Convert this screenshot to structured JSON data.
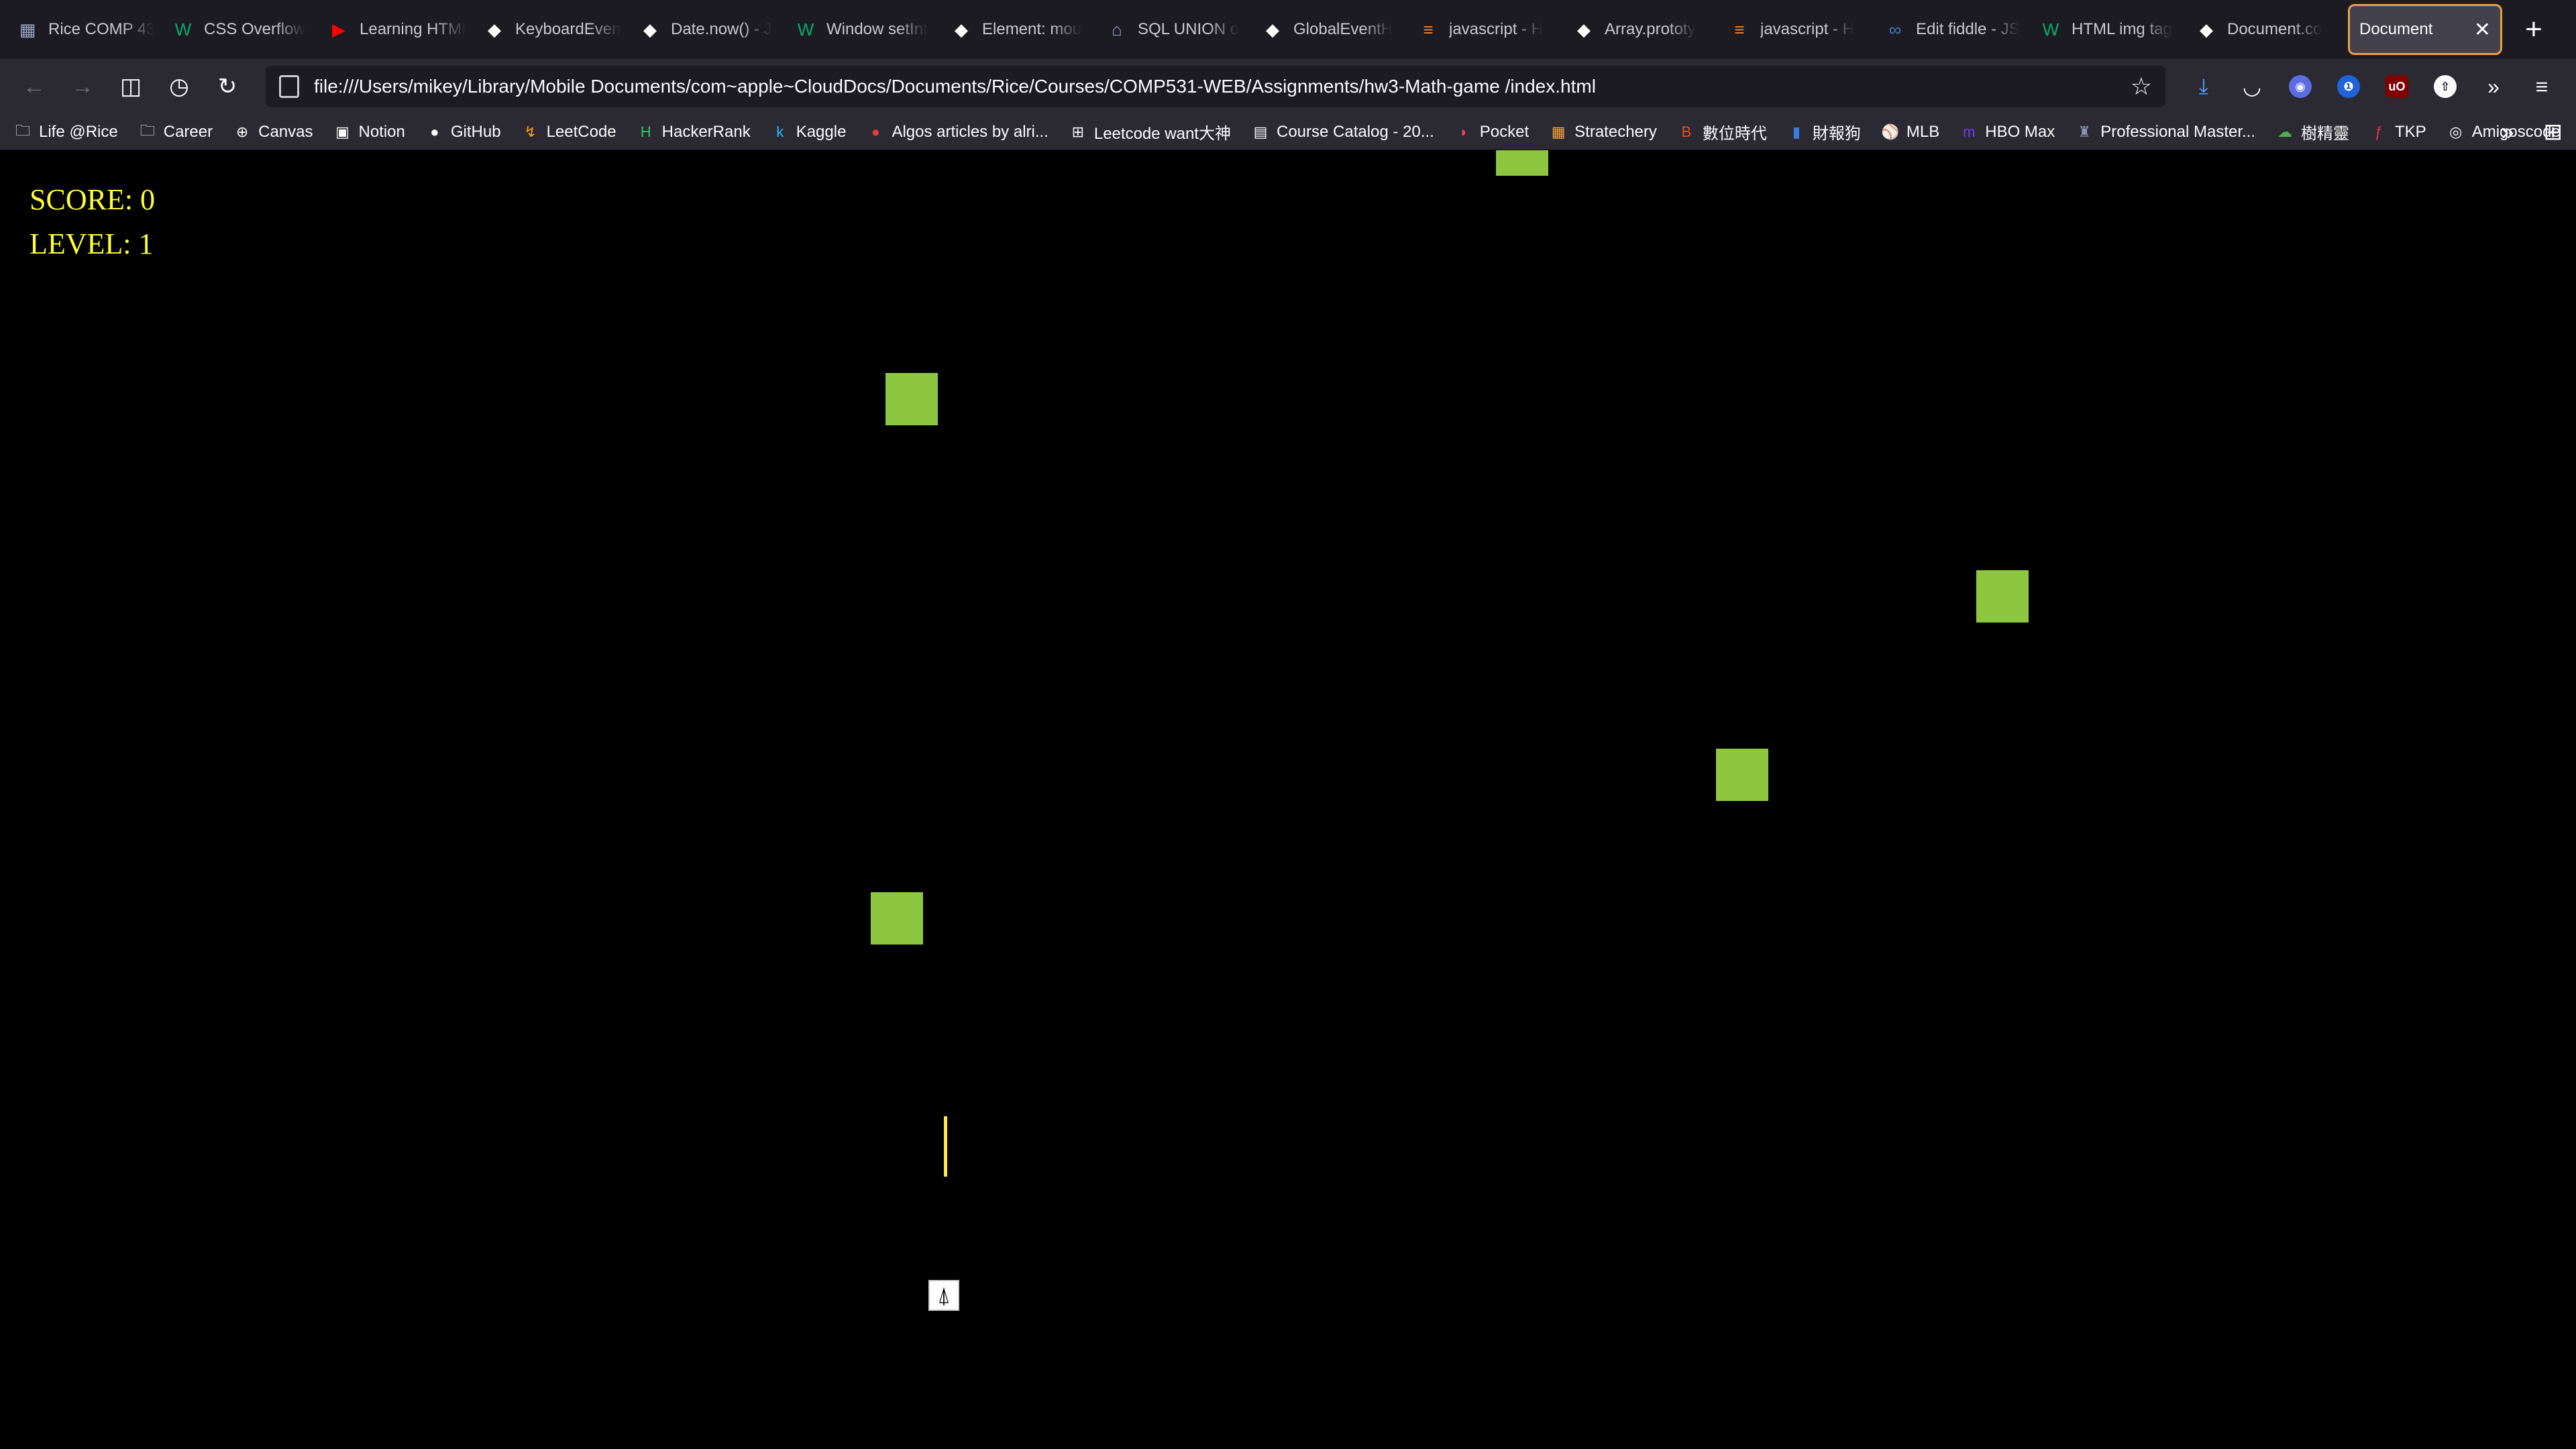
{
  "tabs": [
    {
      "title": "Rice COMP 43",
      "icon": "rice-icon",
      "icon_glyph": "▦",
      "icon_color": "#9aa6c4"
    },
    {
      "title": "CSS Overflow",
      "icon": "w3schools-icon",
      "icon_glyph": "W",
      "icon_color": "#04aa6d"
    },
    {
      "title": "Learning HTML",
      "icon": "youtube-icon",
      "icon_glyph": "▶",
      "icon_color": "#ff0000"
    },
    {
      "title": "KeyboardEvent",
      "icon": "mdn-icon",
      "icon_glyph": "◆",
      "icon_color": "#ffffff"
    },
    {
      "title": "Date.now() - J",
      "icon": "mdn-icon",
      "icon_glyph": "◆",
      "icon_color": "#ffffff"
    },
    {
      "title": "Window setInt",
      "icon": "w3schools-icon",
      "icon_glyph": "W",
      "icon_color": "#04aa6d"
    },
    {
      "title": "Element: mou",
      "icon": "mdn-icon",
      "icon_glyph": "◆",
      "icon_color": "#ffffff"
    },
    {
      "title": "SQL UNION o",
      "icon": "house-icon",
      "icon_glyph": "⌂",
      "icon_color": "#9aa6c4"
    },
    {
      "title": "GlobalEventH",
      "icon": "mdn-icon",
      "icon_glyph": "◆",
      "icon_color": "#ffffff"
    },
    {
      "title": "javascript - H",
      "icon": "stackoverflow-icon",
      "icon_glyph": "≡",
      "icon_color": "#f48024"
    },
    {
      "title": "Array.prototy",
      "icon": "mdn-icon",
      "icon_glyph": "◆",
      "icon_color": "#ffffff"
    },
    {
      "title": "javascript - H",
      "icon": "stackoverflow-icon",
      "icon_glyph": "≡",
      "icon_color": "#f48024"
    },
    {
      "title": "Edit fiddle - JS",
      "icon": "jsfiddle-icon",
      "icon_glyph": "∞",
      "icon_color": "#4679bd"
    },
    {
      "title": "HTML img tag",
      "icon": "w3schools-icon",
      "icon_glyph": "W",
      "icon_color": "#04aa6d"
    },
    {
      "title": "Document.co",
      "icon": "mdn-icon",
      "icon_glyph": "◆",
      "icon_color": "#ffffff"
    }
  ],
  "active_tab": {
    "title": "Document",
    "close": "✕"
  },
  "new_tab": "+",
  "url": "file:///Users/mikey/Library/Mobile Documents/com~apple~CloudDocs/Documents/Rice/Courses/COMP531-WEB/Assignments/hw3-Math-game /index.html",
  "bookmarks": [
    {
      "label": "Life @Rice",
      "icon": "folder-icon",
      "glyph": "🗀",
      "color": "#fbfbfe"
    },
    {
      "label": "Career",
      "icon": "folder-icon",
      "glyph": "🗀",
      "color": "#fbfbfe"
    },
    {
      "label": "Canvas",
      "icon": "globe-icon",
      "glyph": "⊕",
      "color": "#fbfbfe"
    },
    {
      "label": "Notion",
      "icon": "notion-icon",
      "glyph": "▣",
      "color": "#fbfbfe"
    },
    {
      "label": "GitHub",
      "icon": "github-icon",
      "glyph": "●",
      "color": "#fbfbfe"
    },
    {
      "label": "LeetCode",
      "icon": "leetcode-icon",
      "glyph": "↯",
      "color": "#f89f1b"
    },
    {
      "label": "HackerRank",
      "icon": "hackerrank-icon",
      "glyph": "H",
      "color": "#2ec866"
    },
    {
      "label": "Kaggle",
      "icon": "kaggle-icon",
      "glyph": "k",
      "color": "#20beff"
    },
    {
      "label": "Algos articles by alri...",
      "icon": "red-dot-icon",
      "glyph": "●",
      "color": "#e53935"
    },
    {
      "label": "Leetcode want大神",
      "icon": "leetcode-want-icon",
      "glyph": "⊞",
      "color": "#fbfbfe"
    },
    {
      "label": "Course Catalog - 20...",
      "icon": "catalog-icon",
      "glyph": "▤",
      "color": "#fbfbfe"
    },
    {
      "label": "Pocket",
      "icon": "pocket-icon",
      "glyph": "◗",
      "color": "#ef4056"
    },
    {
      "label": "Stratechery",
      "icon": "stratechery-icon",
      "glyph": "▦",
      "color": "#f7a23a"
    },
    {
      "label": "數位時代",
      "icon": "bnext-icon",
      "glyph": "B",
      "color": "#e84e1b"
    },
    {
      "label": "財報狗",
      "icon": "statementdog-icon",
      "glyph": "▮",
      "color": "#3a7bd5"
    },
    {
      "label": "MLB",
      "icon": "mlb-icon",
      "glyph": "⚾",
      "color": "#fbfbfe"
    },
    {
      "label": "HBO Max",
      "icon": "hbo-icon",
      "glyph": "m",
      "color": "#6a3df0"
    },
    {
      "label": "Professional Master...",
      "icon": "rice-owl-icon",
      "glyph": "♜",
      "color": "#8a8fb5"
    },
    {
      "label": "樹精靈",
      "icon": "tree-icon",
      "glyph": "☁",
      "color": "#4caf50"
    },
    {
      "label": "TKP",
      "icon": "tkp-icon",
      "glyph": "ƒ",
      "color": "#e53935"
    },
    {
      "label": "Amigoscode",
      "icon": "amigoscode-icon",
      "glyph": "◎",
      "color": "#fbfbfe"
    }
  ],
  "game": {
    "score_label": "SCORE: 0",
    "level_label": "LEVEL: 1",
    "hud_color": "#ffff33",
    "block_color": "#8dc63f",
    "block_count": 6,
    "player": "rocket-ship",
    "player_glyph": "⍋"
  }
}
